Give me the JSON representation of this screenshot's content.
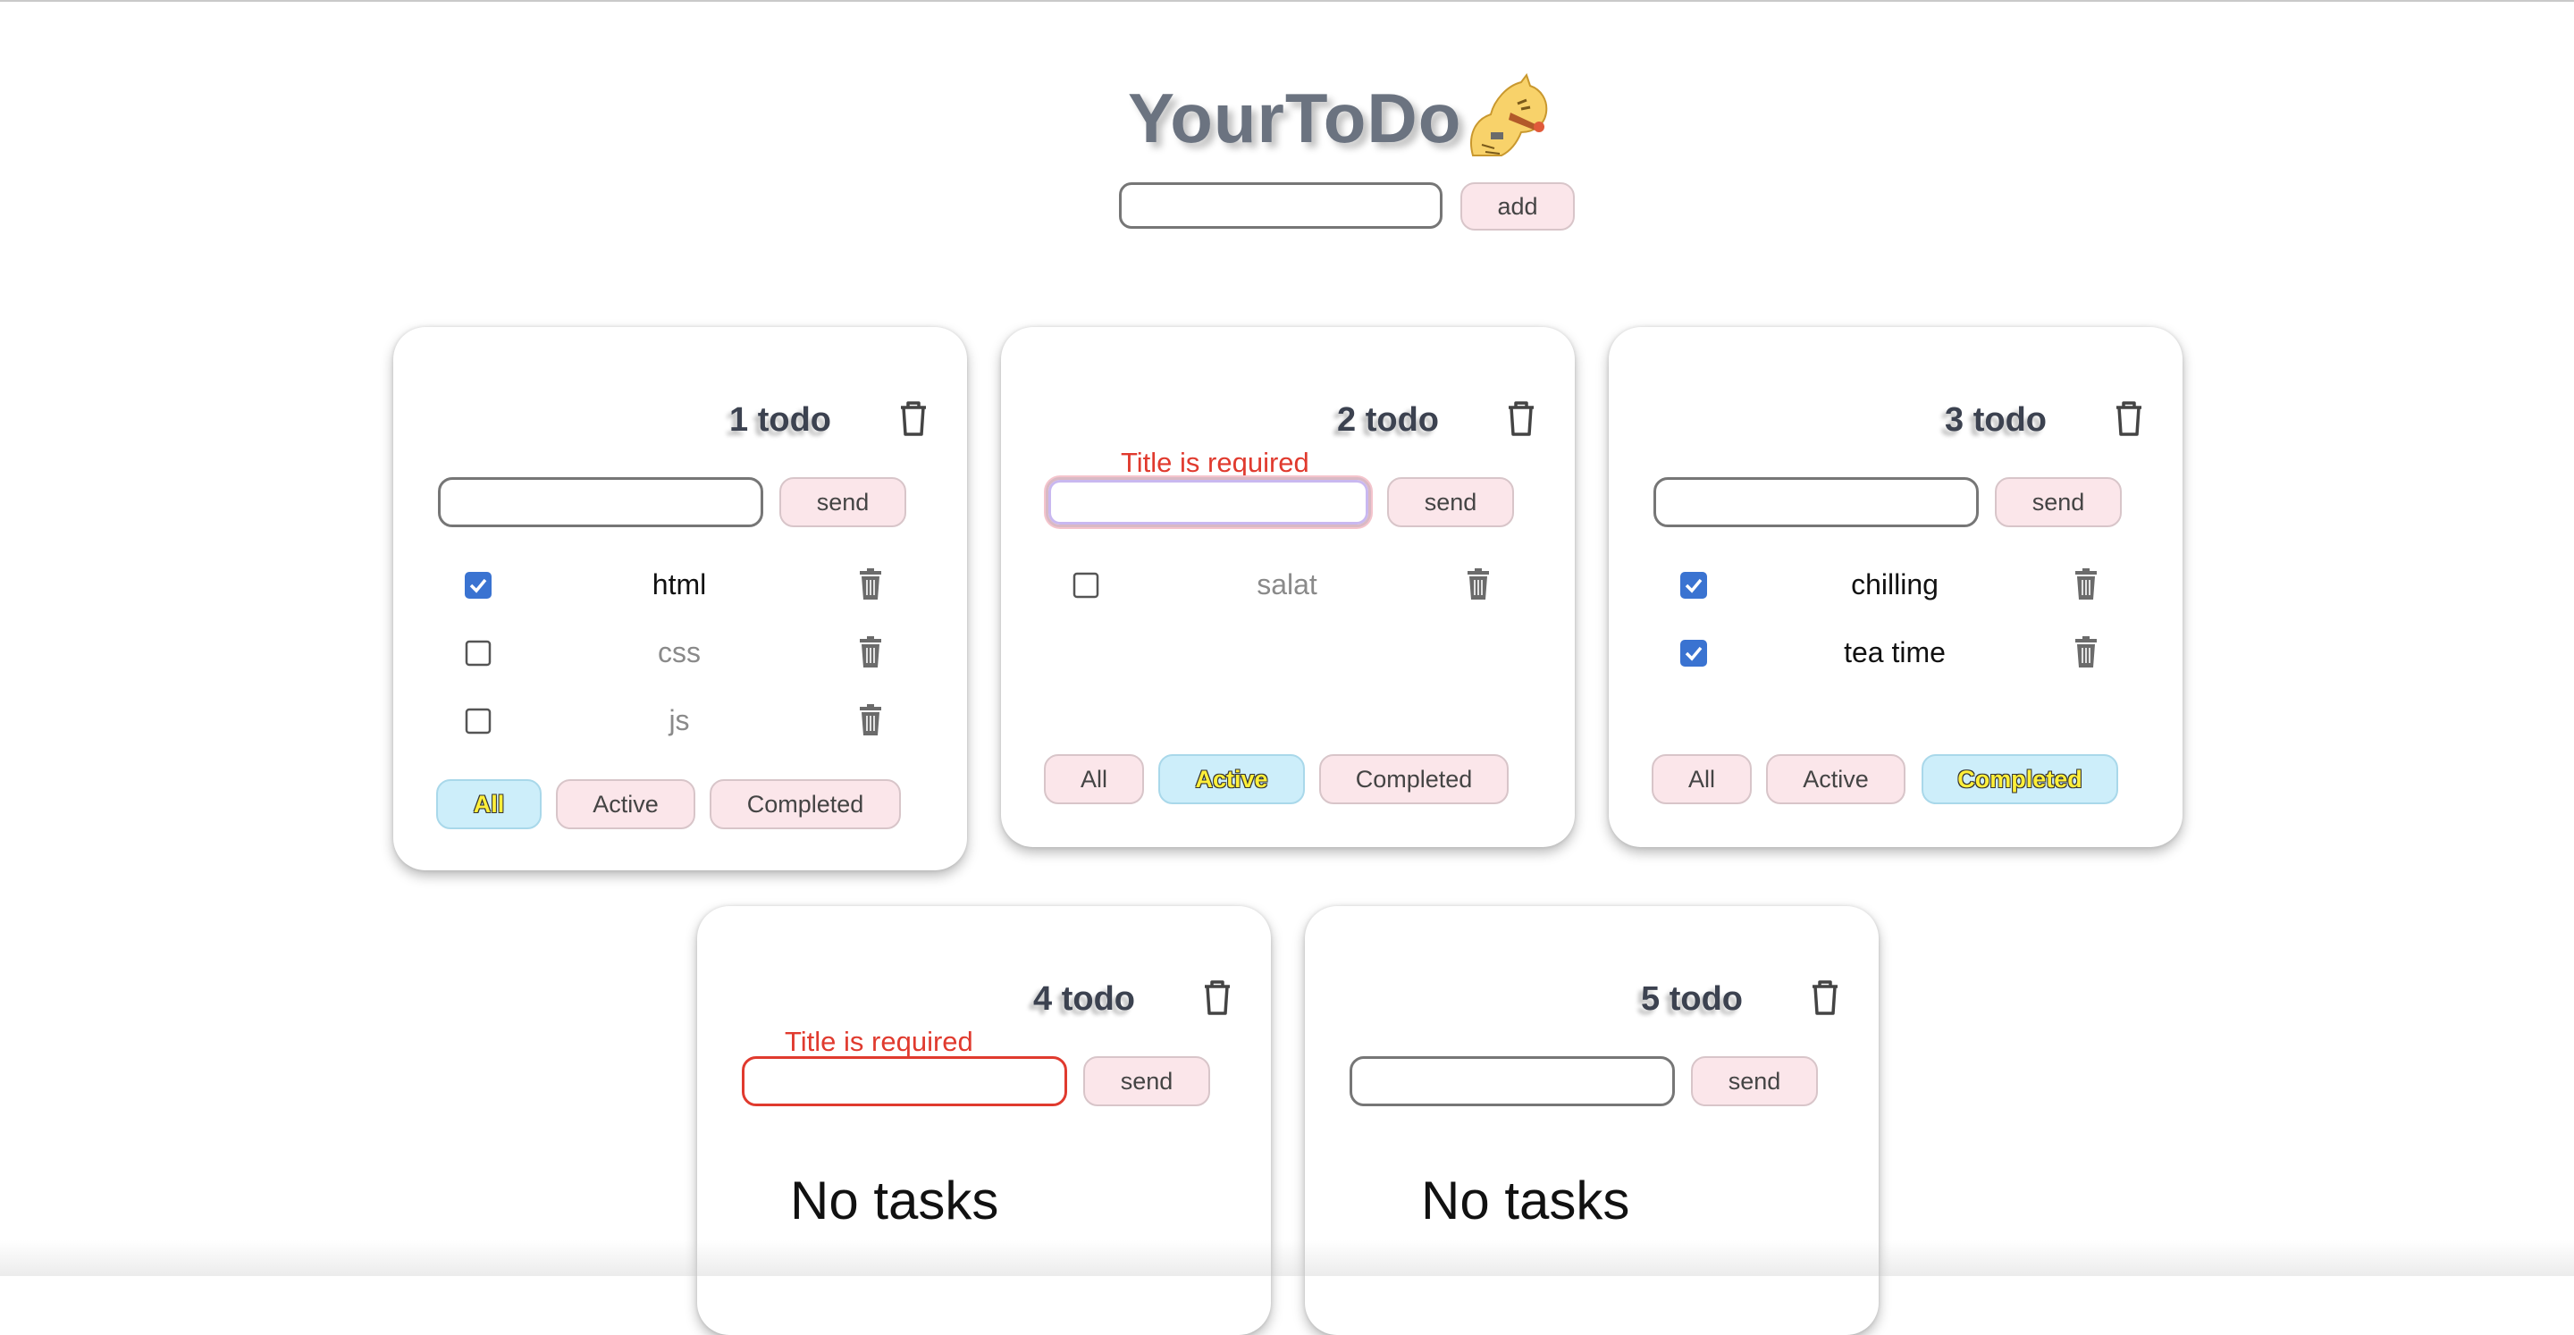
{
  "app": {
    "title": "YourToDo",
    "add_input_value": "",
    "add_label": "add"
  },
  "cards": [
    {
      "title": "1 todo",
      "input_value": "",
      "send_label": "send",
      "tasks": [
        {
          "label": "html",
          "checked": true
        },
        {
          "label": "css",
          "checked": false
        },
        {
          "label": "js",
          "checked": false
        }
      ],
      "filters": [
        "All",
        "Active",
        "Completed"
      ],
      "active_filter": "All"
    },
    {
      "title": "2 todo",
      "error": "Title is required",
      "input_value": "",
      "send_label": "send",
      "tasks": [
        {
          "label": "salat",
          "checked": false
        }
      ],
      "filters": [
        "All",
        "Active",
        "Completed"
      ],
      "active_filter": "Active"
    },
    {
      "title": "3 todo",
      "input_value": "",
      "send_label": "send",
      "tasks": [
        {
          "label": "chilling",
          "checked": true
        },
        {
          "label": "tea time",
          "checked": true
        }
      ],
      "filters": [
        "All",
        "Active",
        "Completed"
      ],
      "active_filter": "Completed"
    },
    {
      "title": "4 todo",
      "error": "Title is required",
      "input_value": "",
      "send_label": "send",
      "empty_text": "No tasks"
    },
    {
      "title": "5 todo",
      "input_value": "",
      "send_label": "send",
      "empty_text": "No tasks"
    }
  ],
  "colors": {
    "filter_bg": "#fbe6ea",
    "active_filter_bg": "#cdeefa",
    "error": "#e03a2e",
    "checkbox": "#3a73d1"
  }
}
